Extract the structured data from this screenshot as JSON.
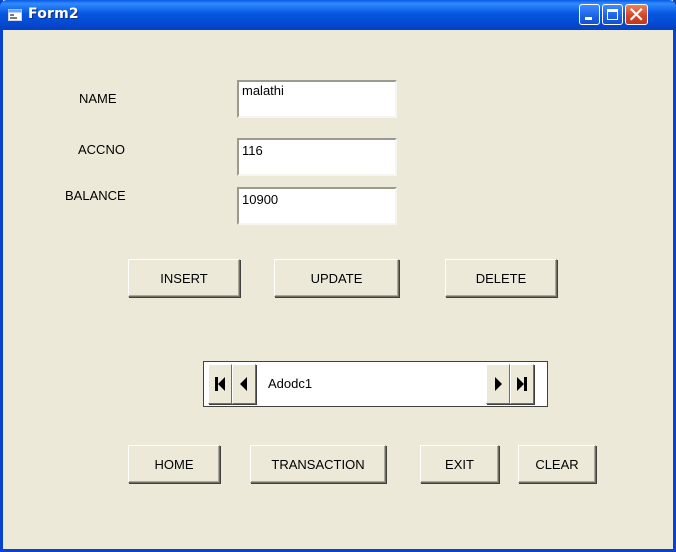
{
  "window": {
    "title": "Form2"
  },
  "labels": {
    "name": "NAME",
    "accno": "ACCNO",
    "balance": "BALANCE"
  },
  "fields": {
    "name_value": "malathi",
    "accno_value": "116",
    "balance_value": "10900"
  },
  "buttons": {
    "insert": "INSERT",
    "update": "UPDATE",
    "delete": "DELETE",
    "home": "HOME",
    "transaction": "TRANSACTION",
    "exit": "EXIT",
    "clear": "CLEAR"
  },
  "data_control": {
    "caption": "Adodc1",
    "icons": [
      "move-first-icon",
      "move-previous-icon",
      "move-next-icon",
      "move-last-icon"
    ]
  },
  "colors": {
    "titlebar": "#0757e0",
    "form_background": "#ece9d8",
    "close_button": "#d6462a"
  }
}
